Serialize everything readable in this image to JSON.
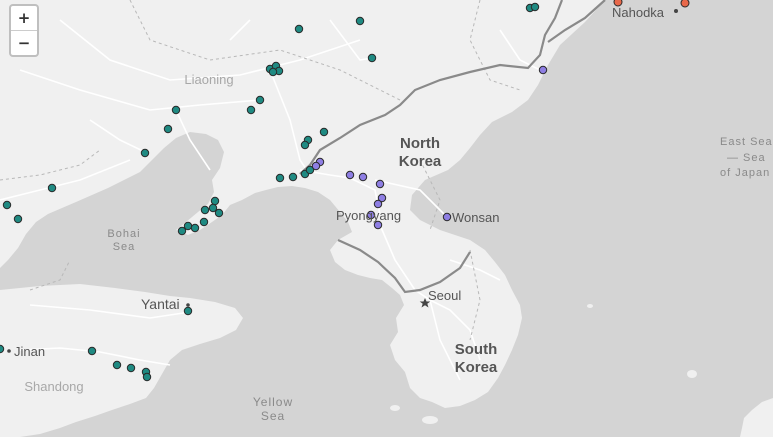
{
  "controls": {
    "zoom_in": "+",
    "zoom_out": "−"
  },
  "colors": {
    "land": "#f0f0f0",
    "sea": "#d4d4d4",
    "road": "#ffffff",
    "border": "#8a8a8a",
    "china_marker": "#1f8a82",
    "north_korea_marker": "#8e7ee3",
    "russia_marker": "#e8684a",
    "marker_stroke": "#2a2a2a"
  },
  "labels": {
    "north_korea_line1": "North",
    "north_korea_line2": "Korea",
    "south_korea_line1": "South",
    "south_korea_line2": "Korea",
    "liaoning": "Liaoning",
    "shandong": "Shandong",
    "bohai_line1": "Bohai",
    "bohai_line2": "Sea",
    "yellow_line1": "Yellow",
    "yellow_line2": "Sea",
    "east_line1": "East Sea",
    "east_line2": "— Sea",
    "east_line3": "of Japan",
    "pyongyang": "Pyongyang",
    "wonsan": "Wonsan",
    "seoul": "Seoul",
    "yantai": "Yantai",
    "jinan": "Jinan",
    "nahodka": "Nahodka"
  }
}
